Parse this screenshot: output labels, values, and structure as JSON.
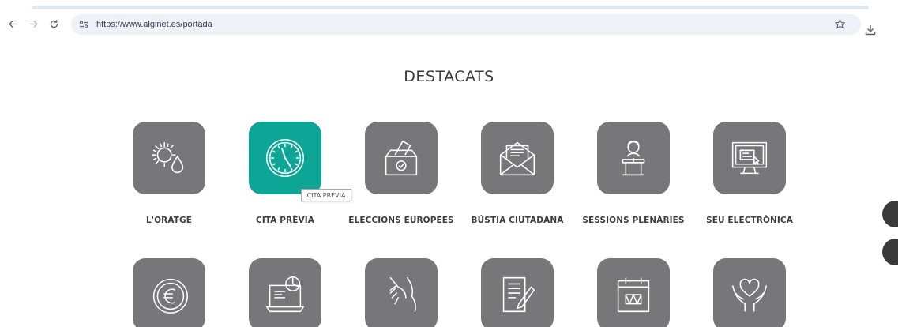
{
  "browser": {
    "url": "https://www.alginet.es/portada",
    "icons": {
      "back": "arrow-left-icon",
      "forward": "arrow-right-icon",
      "reload": "reload-icon",
      "site_info": "site-settings-icon",
      "bookmark": "star-icon",
      "download": "download-icon"
    }
  },
  "page": {
    "title": "DESTACATS",
    "tooltip": "CITA PRÈVIA",
    "tiles_row1": [
      {
        "label": "L'ORATGE",
        "icon": "weather-icon"
      },
      {
        "label": "CITA PRÈVIA",
        "icon": "clock-icon",
        "active": true
      },
      {
        "label": "ELECCIONS EUROPEES",
        "icon": "ballot-box-icon"
      },
      {
        "label": "BÚSTIA CIUTADANA",
        "icon": "envelope-icon"
      },
      {
        "label": "SESSIONS PLENÀRIES",
        "icon": "speaker-podium-icon"
      },
      {
        "label": "SEU ELECTRÒNICA",
        "icon": "computer-icon"
      }
    ],
    "tiles_row2": [
      {
        "icon": "euro-coin-icon"
      },
      {
        "icon": "laptop-chart-icon"
      },
      {
        "icon": "handshake-icon"
      },
      {
        "icon": "document-pen-icon"
      },
      {
        "icon": "calendar-drum-icon"
      },
      {
        "icon": "hands-heart-icon"
      }
    ]
  },
  "colors": {
    "tile": "#777779",
    "tile_active": "#0ca596",
    "text": "#3d3d3d"
  }
}
